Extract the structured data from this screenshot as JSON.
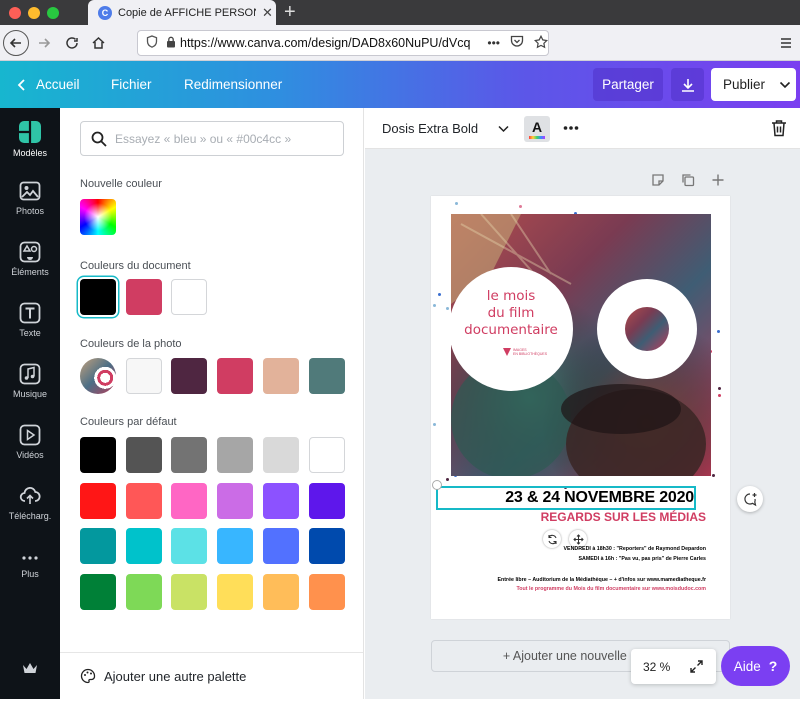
{
  "browser": {
    "tab_title": "Copie de AFFICHE PERSONNALISÉE",
    "tab_favicon": "C",
    "url": "https://www.canva.com/design/DAD8x60NuPU/dVcq",
    "url_more": "•••"
  },
  "header": {
    "back_label": "Accueil",
    "file_label": "Fichier",
    "resize_label": "Redimensionner",
    "share_label": "Partager",
    "publish_label": "Publier"
  },
  "rail": {
    "items": [
      {
        "label": "Modèles"
      },
      {
        "label": "Photos"
      },
      {
        "label": "Éléments"
      },
      {
        "label": "Texte"
      },
      {
        "label": "Musique"
      },
      {
        "label": "Vidéos"
      },
      {
        "label": "Télécharg."
      },
      {
        "label": "Plus"
      }
    ]
  },
  "panel": {
    "search_placeholder": "Essayez « bleu » ou « #00c4cc »",
    "new_color_title": "Nouvelle couleur",
    "document_colors_title": "Couleurs du document",
    "document_colors": [
      "#000000",
      "#d03d62",
      "#ffffff"
    ],
    "photo_colors_title": "Couleurs de la photo",
    "photo_colors": [
      "#f7f7f7",
      "#4f2641",
      "#d03d62",
      "#e2b29a",
      "#507a7a"
    ],
    "default_colors_title": "Couleurs par défaut",
    "default_colors": [
      [
        "#000000",
        "#545454",
        "#737373",
        "#a6a6a6",
        "#d9d9d9",
        "#ffffff"
      ],
      [
        "#ff1616",
        "#ff5757",
        "#ff66c4",
        "#cb6ce6",
        "#8c52ff",
        "#5e17eb"
      ],
      [
        "#03989e",
        "#00c2cb",
        "#5ce1e6",
        "#38b6ff",
        "#5271ff",
        "#004aad"
      ],
      [
        "#008037",
        "#7ed957",
        "#c9e265",
        "#ffde59",
        "#ffbd59",
        "#ff914d"
      ]
    ],
    "add_palette_label": "Ajouter une autre palette"
  },
  "toolbar": {
    "font_name": "Dosis Extra Bold",
    "text_color_letter": "A"
  },
  "poster": {
    "circle_line1": "le mois",
    "circle_line2": "du film",
    "circle_line3": "documentaire",
    "logo_text1": "IMAGES",
    "logo_text2": "EN BIBLIOTHÈQUES",
    "dates": "23 & 24 NOVEMBRE 2020",
    "subtitle": "REGARDS SUR LES MÉDIAS",
    "line1": "VENDREDI à 18h30 : \"Reporters\" de Raymond Depardon",
    "line2": "SAMEDI à 16h : \"Pas vu, pas pris\" de Pierre Carles",
    "line3": "Entrée libre – Auditorium de la Médiathèque – + d'infos sur www.mamediatheque.fr",
    "line4": "Tout le programme du Mois du film documentaire sur www.moisdudoc.com"
  },
  "canvas": {
    "add_page_label": "+ Ajouter une nouvelle page",
    "zoom_label": "32 %",
    "help_label": "Aide",
    "help_symbol": "?"
  },
  "colors": {
    "accent_purple": "#7b3ff2",
    "brand_pink": "#d03d62",
    "selection_teal": "#16b9c7"
  }
}
